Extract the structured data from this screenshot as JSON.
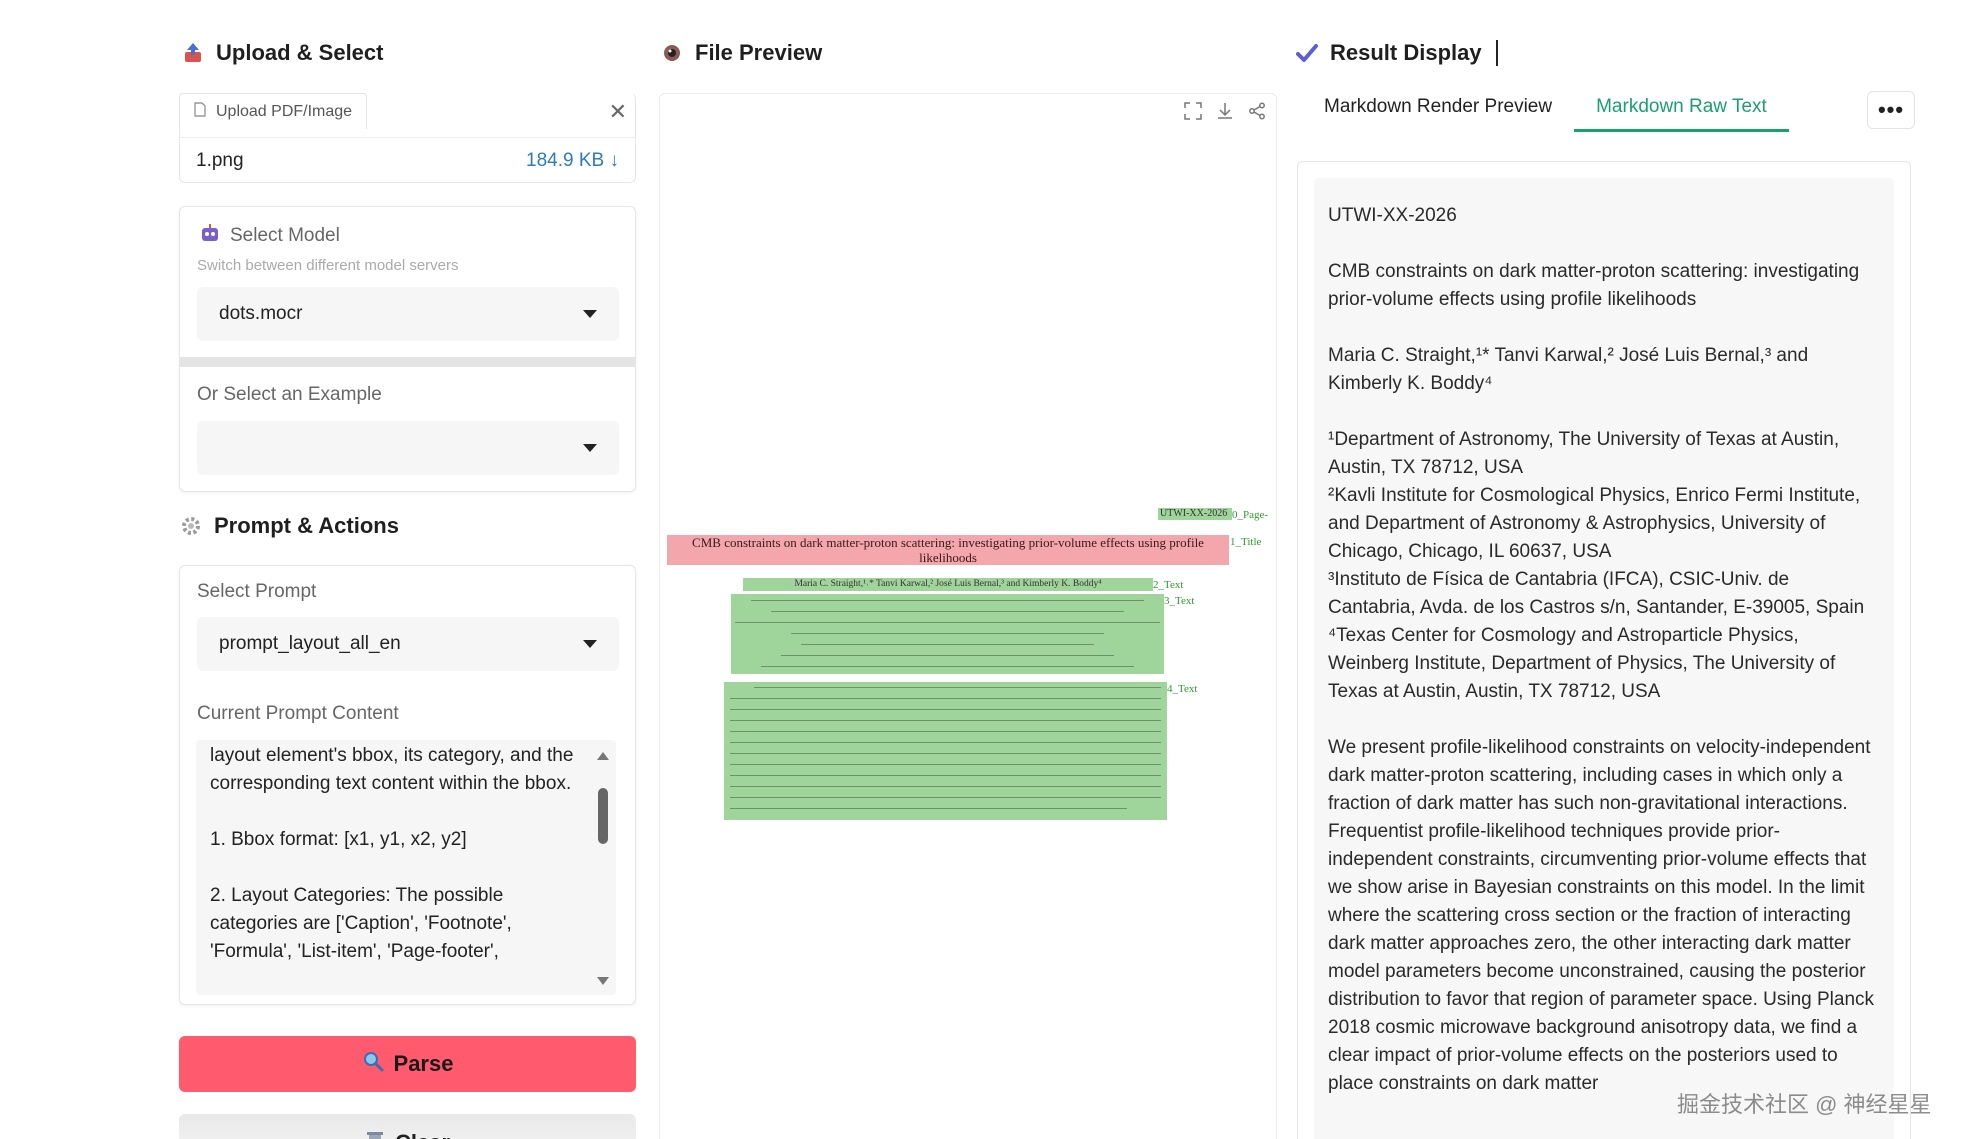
{
  "upload_section": {
    "title": "Upload & Select",
    "upload_tab_label": "Upload PDF/Image",
    "file_name": "1.png",
    "file_size": "184.9 KB ↓"
  },
  "model": {
    "label": "Select Model",
    "hint": "Switch between different model servers",
    "selected": "dots.mocr"
  },
  "example": {
    "label": "Or Select an Example",
    "selected": ""
  },
  "prompt_section": {
    "title": "Prompt & Actions",
    "select_label": "Select Prompt",
    "selected_prompt": "prompt_layout_all_en",
    "content_label": "Current Prompt Content",
    "content_text": "layout element's bbox, its category, and the corresponding text content within the bbox.\n\n1. Bbox format: [x1, y1, x2, y2]\n\n2. Layout Categories: The possible categories are ['Caption', 'Footnote', 'Formula', 'List-item', 'Page-footer',"
  },
  "buttons": {
    "parse": "Parse",
    "clear": "Clear"
  },
  "preview": {
    "title": "File Preview",
    "boxes": [
      {
        "label": "0_Page-",
        "text": "UTWI-XX-2026"
      },
      {
        "label": "1_Title",
        "text": "CMB constraints on dark matter-proton scattering: investigating prior-volume effects using profile likelihoods"
      },
      {
        "label": "2_Text",
        "text": "Maria C. Straight,¹˒* Tanvi Karwal,² José Luis Bernal,³ and Kimberly K. Boddy⁴"
      },
      {
        "label": "3_Text",
        "text": ""
      },
      {
        "label": "4_Text",
        "text": ""
      }
    ]
  },
  "result": {
    "title": "Result Display",
    "tabs": [
      "Markdown Render Preview",
      "Markdown Raw Text"
    ],
    "active_tab": 1,
    "more_label": "•••",
    "paragraphs": [
      "UTWI-XX-2026",
      "CMB constraints on dark matter-proton scattering: investigating prior-volume effects using profile likelihoods",
      "Maria C. Straight,¹* Tanvi Karwal,² José Luis Bernal,³ and Kimberly K. Boddy⁴"
    ],
    "affiliations": [
      "¹Department of Astronomy, The University of Texas at Austin, Austin, TX 78712, USA",
      "²Kavli Institute for Cosmological Physics, Enrico Fermi Institute, and Department of Astronomy & Astrophysics, University of Chicago, Chicago, IL 60637, USA",
      "³Instituto de Física de Cantabria (IFCA), CSIC-Univ. de Cantabria, Avda. de los Castros s/n, Santander, E-39005, Spain",
      "⁴Texas Center for Cosmology and Astroparticle Physics, Weinberg Institute, Department of Physics, The University of Texas at Austin, Austin, TX 78712, USA"
    ],
    "abstract": "We present profile-likelihood constraints on velocity-independent dark matter-proton scattering, including cases in which only a fraction of dark matter has such non-gravitational interactions. Frequentist profile-likelihood techniques provide prior-independent constraints, circumventing prior-volume effects that we show arise in Bayesian constraints on this model. In the limit where the scattering cross section or the fraction of interacting dark matter approaches zero, the other interacting dark matter model parameters become unconstrained, causing the posterior distribution to favor that region of parameter space. Using Planck 2018 cosmic microwave background anisotropy data, we find a clear impact of prior-volume effects on the posteriors used to place constraints on dark matter"
  },
  "watermark": "掘金技术社区 @ 神经星星",
  "colors": {
    "accent_green": "#1aa06a",
    "parse_button": "#ff5a6e",
    "title_box": "#f4a6ad",
    "text_box": "#9fd49a",
    "file_size_blue": "#2b7bc1"
  }
}
